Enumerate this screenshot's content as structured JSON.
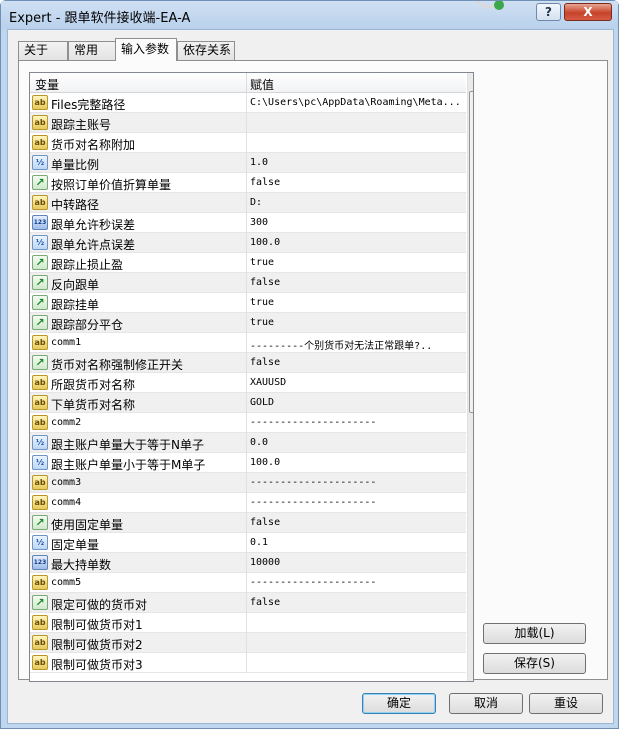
{
  "window": {
    "title": "Expert - 跟单软件接收端-EA-A",
    "help_label": "?",
    "close_label": "X"
  },
  "tabs": [
    {
      "label": "关于"
    },
    {
      "label": "常用"
    },
    {
      "label": "输入参数",
      "active": true
    },
    {
      "label": "依存关系"
    }
  ],
  "grid": {
    "col_variable": "变量",
    "col_value": "赋值",
    "rows": [
      {
        "icon": "ab",
        "name": "Files完整路径",
        "value": "C:\\Users\\pc\\AppData\\Roaming\\Meta..."
      },
      {
        "icon": "ab",
        "name": "跟踪主账号",
        "value": ""
      },
      {
        "icon": "ab",
        "name": "货币对名称附加",
        "value": ""
      },
      {
        "icon": "½",
        "name": "单量比例",
        "value": "1.0"
      },
      {
        "icon": "↗",
        "name": "按照订单价值折算单量",
        "value": "false"
      },
      {
        "icon": "ab",
        "name": "中转路径",
        "value": "D:"
      },
      {
        "icon": "123",
        "name": "跟单允许秒误差",
        "value": "300"
      },
      {
        "icon": "½",
        "name": "跟单允许点误差",
        "value": "100.0"
      },
      {
        "icon": "↗",
        "name": "跟踪止损止盈",
        "value": "true"
      },
      {
        "icon": "↗",
        "name": "反向跟单",
        "value": "false"
      },
      {
        "icon": "↗",
        "name": "跟踪挂单",
        "value": "true"
      },
      {
        "icon": "↗",
        "name": "跟踪部分平仓",
        "value": "true"
      },
      {
        "icon": "ab",
        "name": "comm1",
        "value": "---------个别货币对无法正常跟单?.."
      },
      {
        "icon": "↗",
        "name": "货币对名称强制修正开关",
        "value": "false"
      },
      {
        "icon": "ab",
        "name": "所跟货币对名称",
        "value": "XAUUSD"
      },
      {
        "icon": "ab",
        "name": "下单货币对名称",
        "value": "GOLD"
      },
      {
        "icon": "ab",
        "name": "comm2",
        "value": "---------------------"
      },
      {
        "icon": "½",
        "name": "跟主账户单量大于等于N单子",
        "value": "0.0"
      },
      {
        "icon": "½",
        "name": "跟主账户单量小于等于M单子",
        "value": "100.0"
      },
      {
        "icon": "ab",
        "name": "comm3",
        "value": "---------------------"
      },
      {
        "icon": "ab",
        "name": "comm4",
        "value": "---------------------"
      },
      {
        "icon": "↗",
        "name": "使用固定单量",
        "value": "false"
      },
      {
        "icon": "½",
        "name": "固定单量",
        "value": "0.1"
      },
      {
        "icon": "123",
        "name": "最大持单数",
        "value": "10000"
      },
      {
        "icon": "ab",
        "name": "comm5",
        "value": "---------------------"
      },
      {
        "icon": "↗",
        "name": "限定可做的货币对",
        "value": "false"
      },
      {
        "icon": "ab",
        "name": "限制可做货币对1",
        "value": ""
      },
      {
        "icon": "ab",
        "name": "限制可做货币对2",
        "value": ""
      },
      {
        "icon": "ab",
        "name": "限制可做货币对3",
        "value": ""
      }
    ]
  },
  "side_buttons": {
    "load_label": "加载(L)",
    "save_label": "保存(S)"
  },
  "footer_buttons": {
    "ok_label": "确定",
    "cancel_label": "取消",
    "reset_label": "重设"
  }
}
